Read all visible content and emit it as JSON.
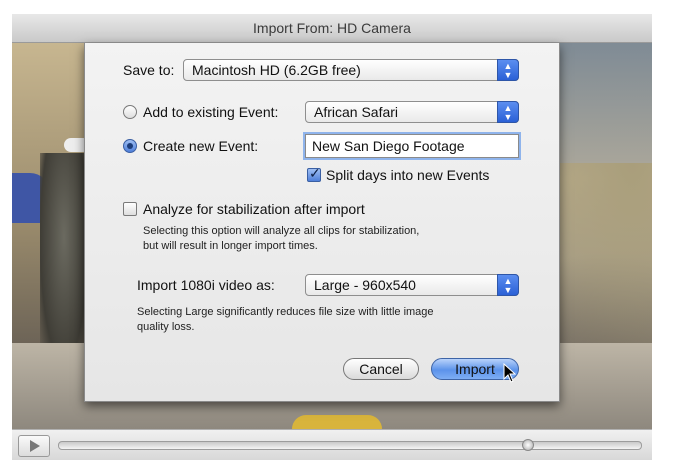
{
  "window": {
    "title": "Import From: HD Camera"
  },
  "dialog": {
    "save_to": {
      "label": "Save to:",
      "value": "Macintosh HD (6.2GB free)"
    },
    "existing_event": {
      "label": "Add to existing Event:",
      "value": "African Safari",
      "selected": false
    },
    "new_event": {
      "label": "Create new Event:",
      "value": "New San Diego Footage",
      "selected": true
    },
    "split_days": {
      "label": "Split days into new Events",
      "checked": true
    },
    "stabilization": {
      "label": "Analyze for stabilization after import",
      "checked": false,
      "help_line1": "Selecting this option will analyze all clips for stabilization,",
      "help_line2": "but will result in longer import times."
    },
    "import_video": {
      "label": "Import 1080i video as:",
      "value": "Large - 960x540",
      "help_line1": "Selecting Large significantly reduces file size with little image",
      "help_line2": "quality loss."
    },
    "buttons": {
      "cancel": "Cancel",
      "import": "Import"
    }
  },
  "player": {
    "progress": 0.81
  },
  "icons": {
    "play": "play-icon",
    "popup": "updown-arrows-icon",
    "check": "checkmark-icon",
    "cursor": "arrow-cursor-icon"
  },
  "colors": {
    "accent": "#4f7fd9",
    "default_button": "#5c93ea"
  }
}
